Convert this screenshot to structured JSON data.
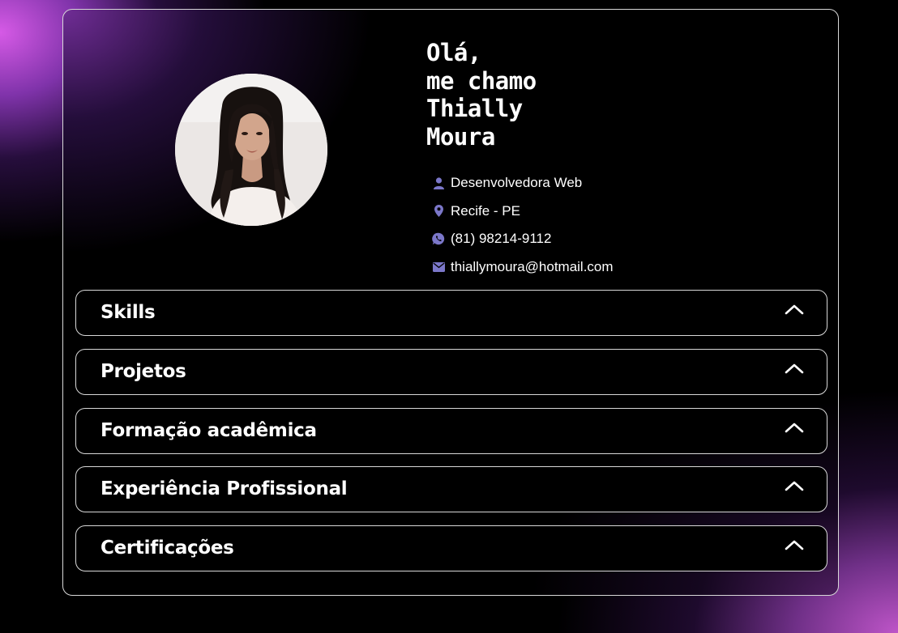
{
  "profile": {
    "greeting_lines": [
      "Olá,",
      "me chamo",
      "Thially",
      "Moura"
    ],
    "photo_icon": "profile-photo"
  },
  "contact": [
    {
      "icon": "user-icon",
      "text": "Desenvolvedora Web"
    },
    {
      "icon": "location-pin-icon",
      "text": "Recife - PE"
    },
    {
      "icon": "whatsapp-icon",
      "text": "(81) 98214-9112"
    },
    {
      "icon": "mail-icon",
      "text": "thiallymoura@hotmail.com"
    }
  ],
  "sections": [
    {
      "label": "Skills",
      "icon": "chevron-up-icon"
    },
    {
      "label": "Projetos",
      "icon": "chevron-up-icon"
    },
    {
      "label": "Formação acadêmica",
      "icon": "chevron-up-icon"
    },
    {
      "label": "Experiência Profissional",
      "icon": "chevron-up-icon"
    },
    {
      "label": "Certificações",
      "icon": "chevron-up-icon"
    }
  ],
  "colors": {
    "icon_accent": "#7b77c9",
    "border": "#d8d8d8",
    "gradient_pink": "#d65ae6",
    "gradient_purple": "#8a3cc8"
  }
}
